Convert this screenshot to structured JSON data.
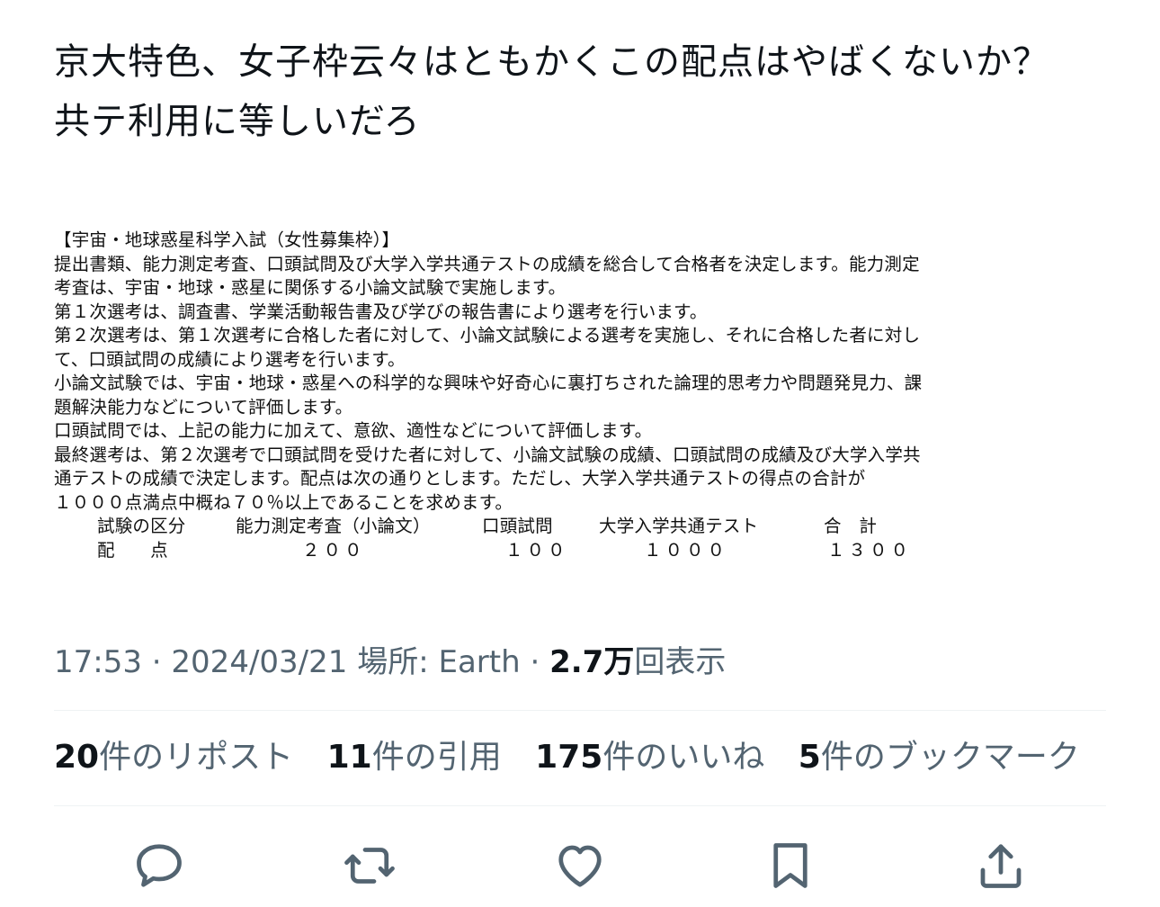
{
  "tweet": {
    "text_lines": [
      "京大特色、女子枠云々はともかくこの配点はやばくないか？",
      "共テ利用に等しいだろ"
    ]
  },
  "attachment": {
    "lines": [
      "【宇宙・地球惑星科学入試（女性募集枠）】",
      "提出書類、能力測定考査、口頭試問及び大学入学共通テストの成績を総合して合格者を決定します。能力測定",
      "考査は、宇宙・地球・惑星に関係する小論文試験で実施します。",
      "第１次選考は、調査書、学業活動報告書及び学びの報告書により選考を行います。",
      "第２次選考は、第１次選考に合格した者に対して、小論文試験による選考を実施し、それに合格した者に対し",
      "て、口頭試問の成績により選考を行います。",
      "小論文試験では、宇宙・地球・惑星への科学的な興味や好奇心に裏打ちされた論理的思考力や問題発見力、課",
      "題解決能力などについて評価します。",
      "口頭試問では、上記の能力に加えて、意欲、適性などについて評価します。",
      "最終選考は、第２次選考で口頭試問を受けた者に対して、小論文試験の成績、口頭試問の成績及び大学入学共",
      "通テストの成績で決定します。配点は次の通りとします。ただし、大学入学共通テストの得点の合計が",
      "１０００点満点中概ね７０％以上であることを求めます。"
    ],
    "score_table": {
      "headers": [
        "試験の区分",
        "能力測定考査（小論文）",
        "口頭試問",
        "大学入学共通テスト",
        "合　計"
      ],
      "row_label": "配　　点",
      "values": [
        "２００",
        "１００",
        "１０００",
        "１３００"
      ]
    }
  },
  "meta": {
    "time": "17:53",
    "separator": " · ",
    "date": "2024/03/21",
    "location": "場所: Earth",
    "views_count": "2.7万",
    "views_label": "回表示"
  },
  "stats": [
    {
      "count": "20",
      "label": "件のリポスト"
    },
    {
      "count": "11",
      "label": "件の引用"
    },
    {
      "count": "175",
      "label": "件のいいね"
    },
    {
      "count": "5",
      "label": "件のブックマーク"
    }
  ],
  "icons": {
    "reply": "reply-icon",
    "repost": "repost-icon",
    "like": "heart-icon",
    "bookmark": "bookmark-icon",
    "share": "share-icon"
  },
  "colors": {
    "text": "#0f1419",
    "secondary": "#536471",
    "divider": "#eff3f4"
  }
}
